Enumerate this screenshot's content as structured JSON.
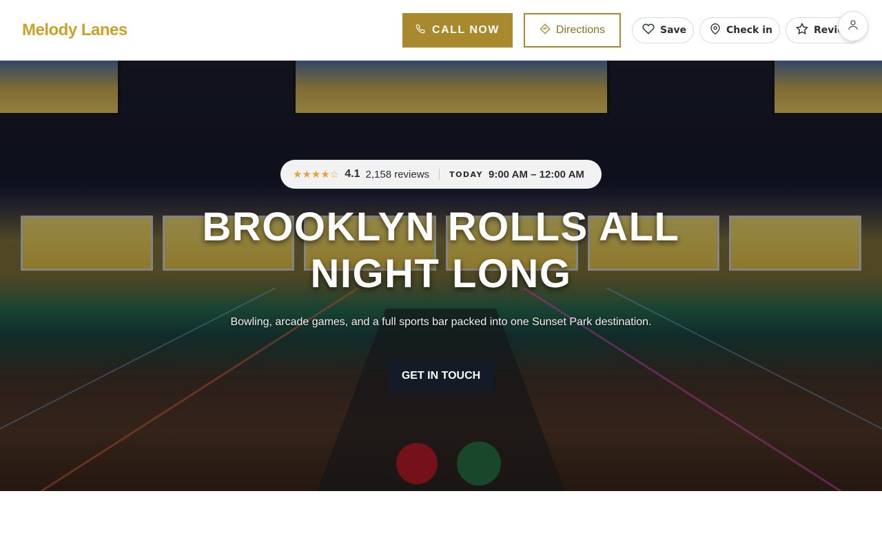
{
  "header": {
    "brand": "Melody Lanes",
    "call_label": "CALL NOW",
    "directions_label": "Directions",
    "save_label": "Save",
    "checkin_label": "Check in",
    "review_label": "Review"
  },
  "hero": {
    "stars": "★★★★☆",
    "rating": "4.1",
    "reviews": "2,158 reviews",
    "today_label": "TODAY",
    "hours": "9:00 AM – 12:00 AM",
    "title": "BROOKLYN ROLLS ALL NIGHT LONG",
    "subtitle": "Bowling, arcade games, and a full sports bar packed into one Sunset Park destination.",
    "cta_label": "GET IN TOUCH"
  },
  "colors": {
    "brand": "#c9a227",
    "accent": "#a8892d",
    "cta_bg": "#141a26",
    "star": "#e7a13a"
  },
  "icons": {
    "call": "phone-icon",
    "directions": "directions-icon",
    "save": "heart-icon",
    "checkin": "map-pin-icon",
    "review": "star-icon",
    "account": "user-icon"
  }
}
